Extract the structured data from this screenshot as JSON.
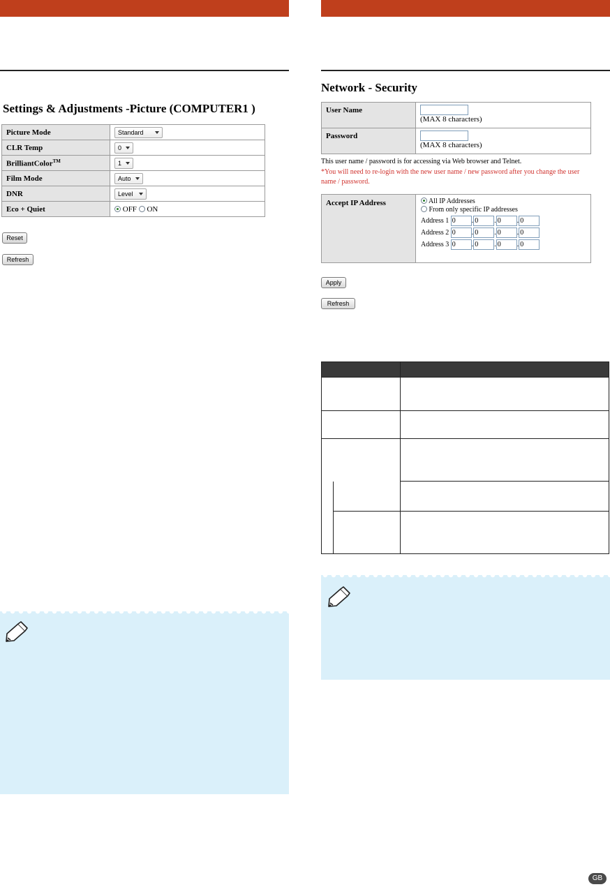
{
  "left_panel": {
    "title": "Settings & Adjustments -Picture (COMPUTER1 )",
    "rows": [
      {
        "label": "Picture Mode",
        "value": "Standard"
      },
      {
        "label": "CLR Temp",
        "value": "0"
      },
      {
        "label": "BrilliantColor",
        "label_sup": "TM",
        "value": "1"
      },
      {
        "label": "Film Mode",
        "value": "Auto"
      },
      {
        "label": "DNR",
        "value": "Level"
      }
    ],
    "eco": {
      "label": "Eco + Quiet",
      "off": "OFF",
      "on": "ON",
      "selected": "OFF"
    },
    "reset_button": "Reset",
    "refresh_button": "Refresh"
  },
  "right_panel": {
    "title": "Network - Security",
    "user_name": {
      "label": "User Name",
      "hint": "(MAX 8 characters)",
      "value": ""
    },
    "password": {
      "label": "Password",
      "hint": "(MAX 8 characters)",
      "value": ""
    },
    "info_text": "This user name / password is for accessing via Web browser and Telnet.",
    "warning_text": "*You will need to re-login with the new user name / new password after you change the user name / password.",
    "warning_color": "#d0312d",
    "accept_ip": {
      "label": "Accept IP Address",
      "option_all": "All IP Addresses",
      "option_specific": "From only specific IP addresses",
      "selected": "all",
      "addresses": [
        {
          "label": "Address 1",
          "octets": [
            "0",
            "0",
            "0",
            "0"
          ]
        },
        {
          "label": "Address 2",
          "octets": [
            "0",
            "0",
            "0",
            "0"
          ]
        },
        {
          "label": "Address 3",
          "octets": [
            "0",
            "0",
            "0",
            "0"
          ]
        }
      ]
    },
    "apply_button": "Apply",
    "refresh_button": "Refresh"
  },
  "page_badge": "GB",
  "colors": {
    "header_bar": "#bf3f1c",
    "note_background": "#daf0fa"
  }
}
